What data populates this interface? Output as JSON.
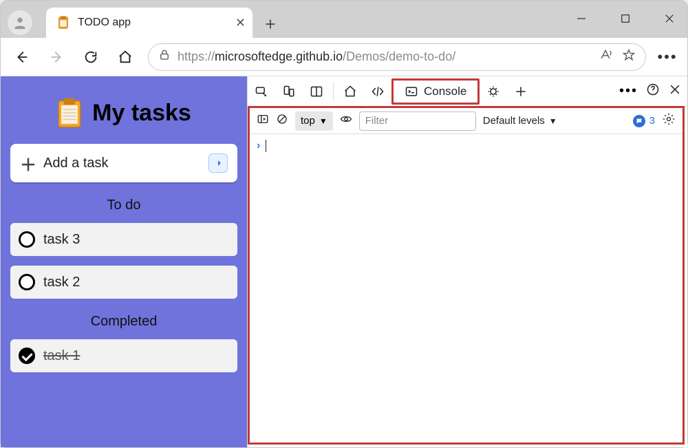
{
  "window": {
    "tab_title": "TODO app"
  },
  "addressbar": {
    "url_prefix": "https://",
    "url_host": "microsoftedge.github.io",
    "url_path": "/Demos/demo-to-do/"
  },
  "app": {
    "title": "My tasks",
    "add_placeholder": "Add a task",
    "sections": {
      "todo_label": "To do",
      "completed_label": "Completed"
    },
    "todo": [
      {
        "name": "task 3"
      },
      {
        "name": "task 2"
      }
    ],
    "completed": [
      {
        "name": "task 1"
      }
    ]
  },
  "devtools": {
    "console_tab_label": "Console",
    "context_label": "top",
    "filter_placeholder": "Filter",
    "levels_label": "Default levels",
    "issue_count": "3"
  }
}
